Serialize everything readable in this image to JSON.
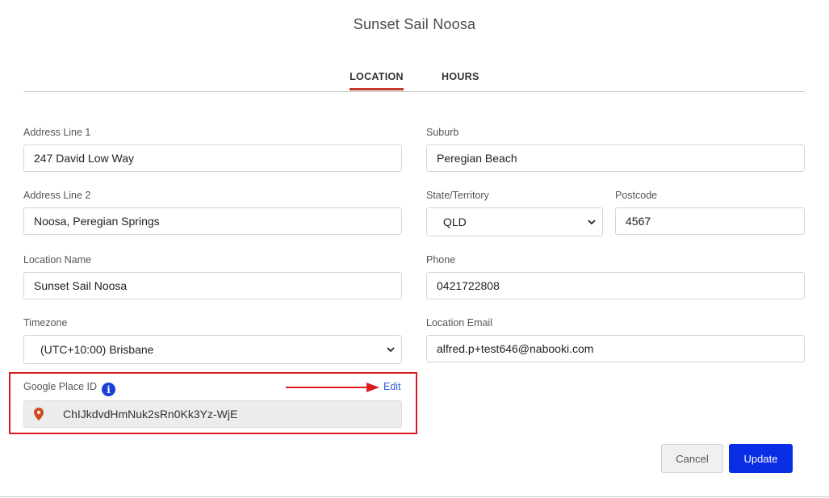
{
  "title": "Sunset Sail Noosa",
  "tabs": [
    {
      "label": "LOCATION",
      "active": true
    },
    {
      "label": "HOURS",
      "active": false
    }
  ],
  "colors": {
    "active_tab_underline": "#c0392b",
    "highlight_box": "#e0191f",
    "primary_button": "#0a2de6",
    "link": "#2a5bd7",
    "info_icon": "#1a3fd6",
    "pin_icon": "#d04a1e"
  },
  "fields": {
    "address1": {
      "label": "Address Line 1",
      "value": "247 David Low Way"
    },
    "suburb": {
      "label": "Suburb",
      "value": "Peregian Beach"
    },
    "address2": {
      "label": "Address Line 2",
      "value": "Noosa, Peregian Springs"
    },
    "state": {
      "label": "State/Territory",
      "value": "QLD"
    },
    "postcode": {
      "label": "Postcode",
      "value": "4567"
    },
    "location_name": {
      "label": "Location Name",
      "value": "Sunset Sail Noosa"
    },
    "phone": {
      "label": "Phone",
      "value": "0421722808"
    },
    "timezone": {
      "label": "Timezone",
      "value": "(UTC+10:00) Brisbane"
    },
    "location_email": {
      "label": "Location Email",
      "value": "alfred.p+test646@nabooki.com"
    }
  },
  "google_place": {
    "label": "Google Place ID",
    "info_icon": "info-icon",
    "edit_label": "Edit",
    "pin_icon": "map-pin-icon",
    "value": "ChIJkdvdHmNuk2sRn0Kk3Yz-WjE"
  },
  "buttons": {
    "cancel": "Cancel",
    "update": "Update"
  }
}
